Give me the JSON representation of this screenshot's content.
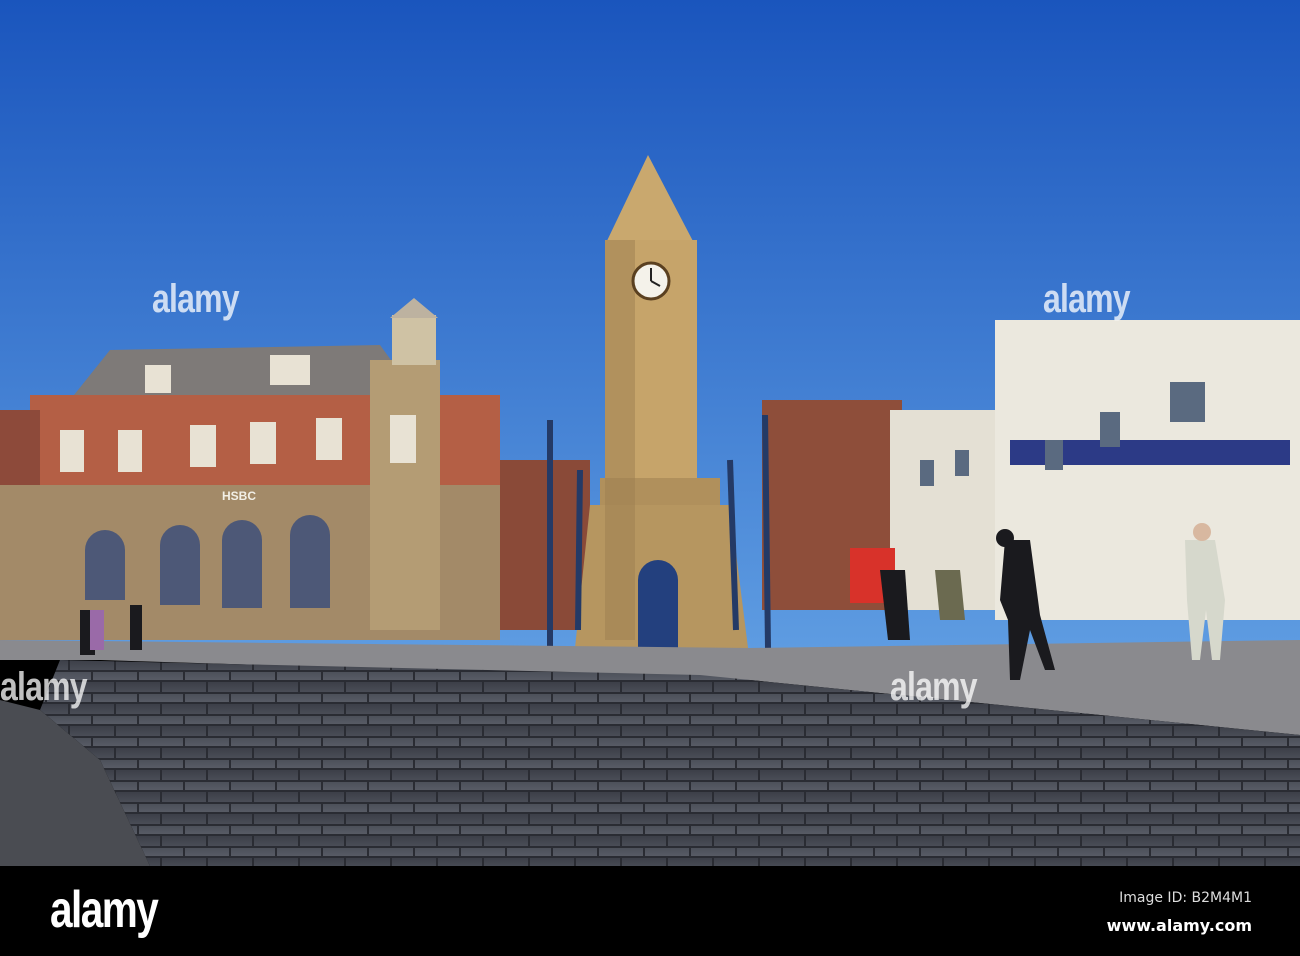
{
  "photo": {
    "subject": "clock-tower-town-square",
    "sky_color": "#1f5fc4",
    "shop_sign": "HSBC"
  },
  "watermark": {
    "text": "alamy"
  },
  "footer": {
    "logo": "alamy",
    "image_id": "Image ID: B2M4M1",
    "website": "www.alamy.com"
  }
}
